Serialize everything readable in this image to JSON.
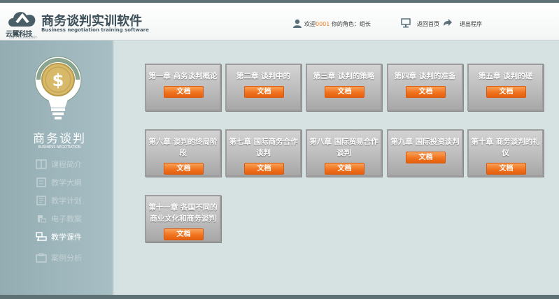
{
  "header": {
    "logo_text": "云翼科技",
    "logo_sub": "YUNYI TECHNOLOGY",
    "title": "商务谈判实训软件",
    "subtitle": "Business negotiation training software",
    "welcome_prefix": "欢迎",
    "user_id": "0001",
    "role_text": "你的角色：组长",
    "home_label": "返回首页",
    "exit_label": "退出程序",
    "accent_color": "#f07b1b"
  },
  "sidebar": {
    "title": "商务谈判",
    "subtitle": "BUSINESS NEGOTIATION",
    "items": [
      {
        "label": "课程简介",
        "icon": "book-icon"
      },
      {
        "label": "教学大纲",
        "icon": "outline-icon"
      },
      {
        "label": "教学计划",
        "icon": "plan-icon"
      },
      {
        "label": "电子教案",
        "icon": "lesson-icon"
      },
      {
        "label": "教学课件",
        "icon": "courseware-icon"
      },
      {
        "label": "案例分析",
        "icon": "case-icon"
      }
    ],
    "active_index": 4
  },
  "chapters": [
    {
      "title": "第一章 商务谈判概论",
      "button": "文档"
    },
    {
      "title": "第二章 谈判中的",
      "button": "文档"
    },
    {
      "title": "第三章 谈判的策略",
      "button": "文档"
    },
    {
      "title": "第四章 谈判的准备",
      "button": "文档"
    },
    {
      "title": "第五章 谈判的磋",
      "button": "文档"
    },
    {
      "title": "第六章 谈判的终局阶段",
      "button": "文档"
    },
    {
      "title": "第七章 国际商务合作谈判",
      "button": "文档"
    },
    {
      "title": "第八章 国际贸易合作谈判",
      "button": "文档"
    },
    {
      "title": "第九章 国际投资谈判",
      "button": "文档"
    },
    {
      "title": "第十章 商务谈判的礼仪",
      "button": "文档"
    },
    {
      "title": "第十一章 各国不同的商业文化和商务谈判",
      "button": "文档"
    }
  ]
}
